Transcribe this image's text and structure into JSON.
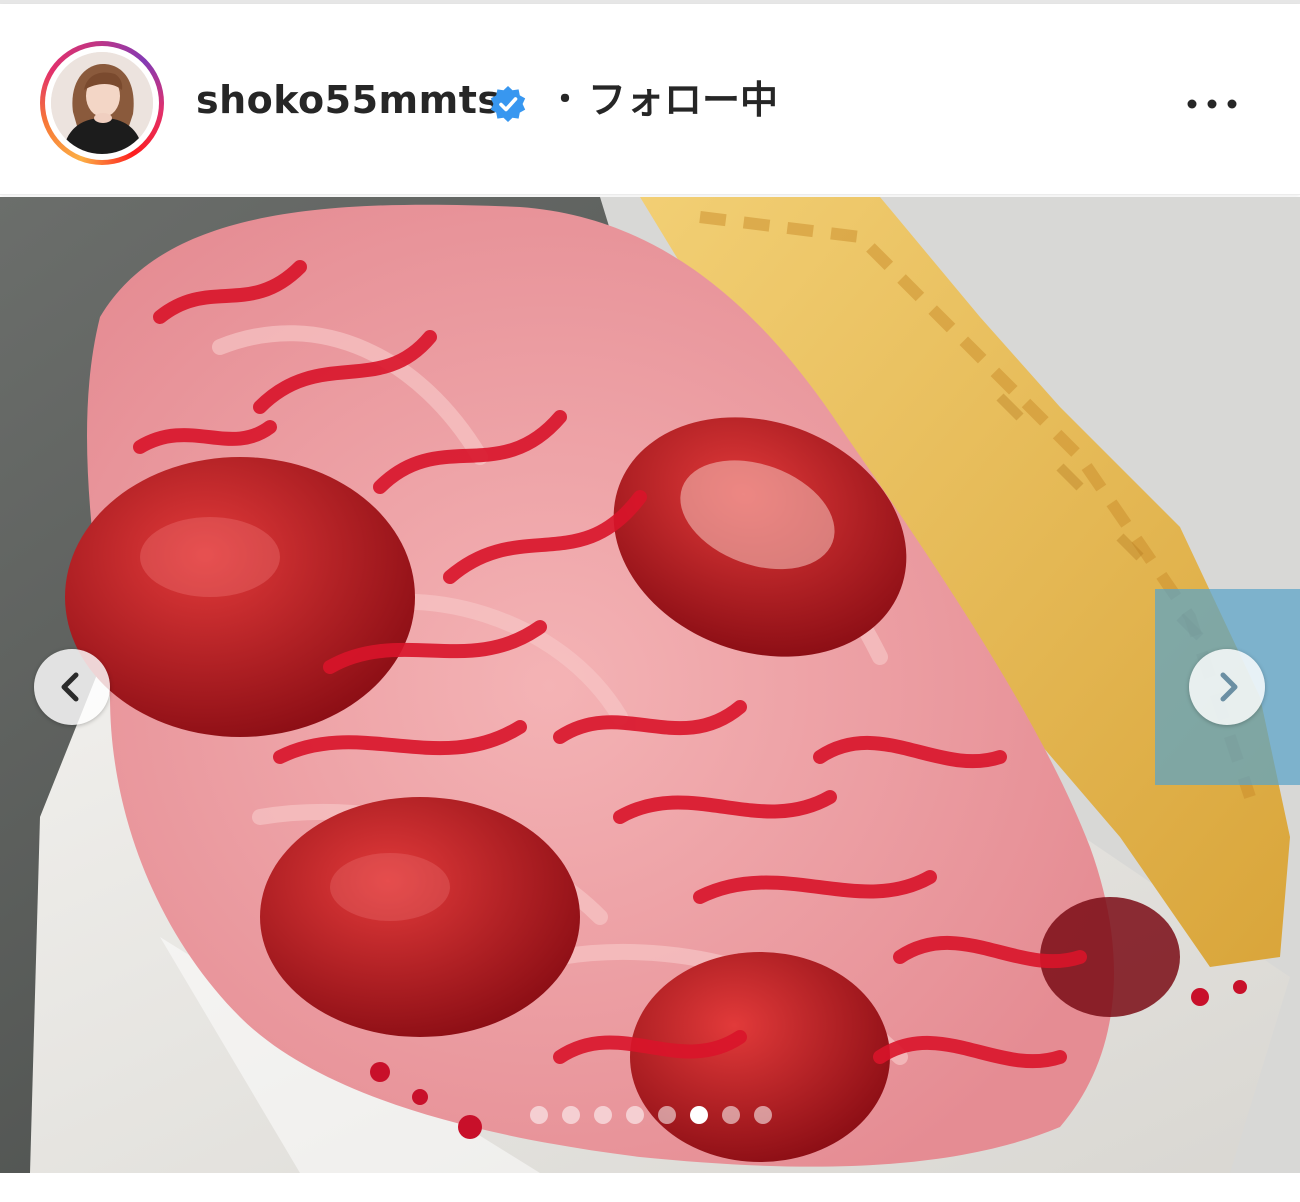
{
  "post": {
    "username": "shoko55mmts",
    "separator": "・",
    "follow_status": "フォロー中"
  },
  "icons": {
    "verified": "verified-badge-icon",
    "more": "more-options-icon",
    "prev": "chevron-left-icon",
    "next": "chevron-right-icon"
  },
  "colors": {
    "verified_blue": "#3897f0",
    "text": "#262626"
  },
  "carousel": {
    "total_slides": 8,
    "active_index": 5
  }
}
